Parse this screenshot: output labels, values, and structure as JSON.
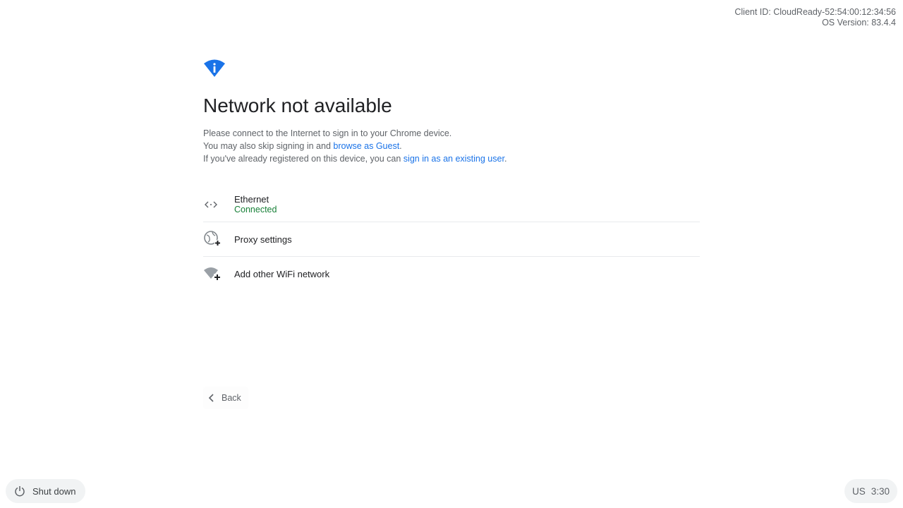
{
  "client_info": {
    "client_id": "Client ID: CloudReady-52:54:00:12:34:56",
    "os_version": "OS Version: 83.4.4"
  },
  "header": {
    "icon": "wifi-info-icon",
    "title": "Network not available"
  },
  "description": {
    "line1": "Please connect to the Internet to sign in to your Chrome device.",
    "line2_prefix": "You may also skip signing in and ",
    "line2_link": "browse as Guest",
    "line2_suffix": ".",
    "line3_prefix": "If you've already registered on this device, you can ",
    "line3_link": "sign in as an existing user",
    "line3_suffix": "."
  },
  "networks": [
    {
      "icon": "ethernet-icon",
      "name": "Ethernet",
      "status": "Connected"
    },
    {
      "icon": "proxy-settings-icon",
      "name": "Proxy settings"
    },
    {
      "icon": "add-wifi-icon",
      "name": "Add other WiFi network"
    }
  ],
  "back_button": {
    "icon": "chevron-left-icon",
    "label": "Back"
  },
  "shelf": {
    "shutdown": {
      "icon": "power-icon",
      "label": "Shut down"
    },
    "ime": "US",
    "time": "3:30"
  },
  "colors": {
    "accent": "#1a73e8",
    "connected": "#188038",
    "text_primary": "#202124",
    "text_secondary": "#5f6368"
  }
}
